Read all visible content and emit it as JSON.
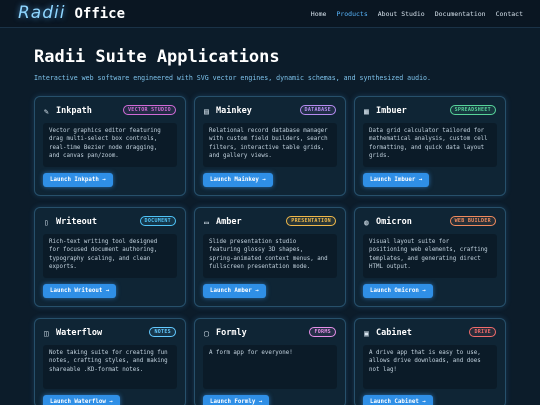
{
  "brand": {
    "name_script": "Radii",
    "name_bold": "Office"
  },
  "nav": [
    {
      "label": "Home",
      "active": false
    },
    {
      "label": "Products",
      "active": true
    },
    {
      "label": "About Studio",
      "active": false
    },
    {
      "label": "Documentation",
      "active": false
    },
    {
      "label": "Contact",
      "active": false
    }
  ],
  "hero": {
    "title": "Radii Suite Applications",
    "subtitle": "Interactive web software engineered with SVG vector engines, dynamic schemas, and synthesized audio."
  },
  "colors": {
    "accent": "#2f8fe6",
    "background": "#0c1c2a"
  },
  "apps": [
    {
      "icon": "pen-icon",
      "glyph": "✎",
      "title": "Inkpath",
      "badge": "VECTOR STUDIO",
      "badge_color": "#d06bd6",
      "description": "Vector graphics editor featuring drag multi-select box controls, real-time Bezier node dragging, and canvas pan/zoom.",
      "launch_label": "Launch Inkpath →"
    },
    {
      "icon": "database-icon",
      "glyph": "▤",
      "title": "Mainkey",
      "badge": "DATABASE",
      "badge_color": "#b68cf0",
      "description": "Relational record database manager with custom field builders, search filters, interactive table grids, and gallery views.",
      "launch_label": "Launch Mainkey →"
    },
    {
      "icon": "spreadsheet-icon",
      "glyph": "▦",
      "title": "Imbuer",
      "badge": "SPREADSHEET",
      "badge_color": "#58d39a",
      "description": "Data grid calculator tailored for mathematical analysis, custom cell formatting, and quick data layout grids.",
      "launch_label": "Launch Imbuer →"
    },
    {
      "icon": "document-icon",
      "glyph": "▯",
      "title": "Writeout",
      "badge": "DOCUMENT",
      "badge_color": "#4fc3f7",
      "description": "Rich-text writing tool designed for focused document authoring, typography scaling, and clean exports.",
      "launch_label": "Launch Writeout →"
    },
    {
      "icon": "presentation-icon",
      "glyph": "▭",
      "title": "Amber",
      "badge": "PRESENTATION",
      "badge_color": "#f0b84a",
      "description": "Slide presentation studio featuring glossy 3D shapes, spring-animated context menus, and fullscreen presentation mode.",
      "launch_label": "Launch Amber →"
    },
    {
      "icon": "globe-icon",
      "glyph": "◍",
      "title": "Omicron",
      "badge": "WEB BUILDER",
      "badge_color": "#f08a5d",
      "description": "Visual layout suite for positioning web elements, crafting templates, and generating direct HTML output.",
      "launch_label": "Launch Omicron →"
    },
    {
      "icon": "notes-icon",
      "glyph": "◫",
      "title": "Waterflow",
      "badge": "NOTES",
      "badge_color": "#63c9ff",
      "description": "Note taking suite for creating fun notes, crafting styles, and making shareable .KD-format notes.",
      "launch_label": "Launch Waterflow →"
    },
    {
      "icon": "form-icon",
      "glyph": "▢",
      "title": "Formly",
      "badge": "FORMS",
      "badge_color": "#e58fe8",
      "description": "A form app for everyone!",
      "launch_label": "Launch Formly →"
    },
    {
      "icon": "drive-icon",
      "glyph": "▣",
      "title": "Cabinet",
      "badge": "DRIVE",
      "badge_color": "#f06b6b",
      "description": "A drive app that is easy to use, allows drive downloads, and does not lag!",
      "launch_label": "Launch Cabinet →"
    }
  ]
}
